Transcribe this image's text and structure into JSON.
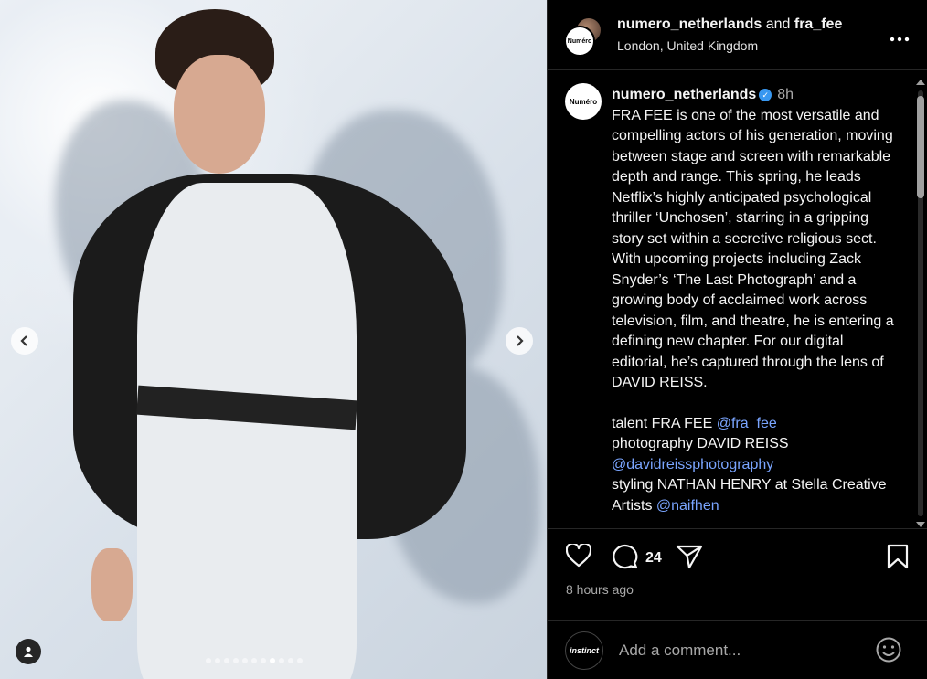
{
  "post": {
    "author": "numero_netherlands",
    "conjunction": "and",
    "collaborator": "fra_fee",
    "location": "London, United Kingdom",
    "author_avatar_text": "Numéro"
  },
  "caption": {
    "username": "numero_netherlands",
    "time": "8h",
    "paragraph": "FRA FEE is one of the most versatile and compelling actors of his generation, moving between stage and screen with remarkable depth and range. This spring, he leads Netflix’s highly anticipated psychological thriller ‘Unchosen’, starring in a gripping story set within a secretive religious sect. With upcoming projects including Zack Snyder’s ‘The Last Photograph’ and a growing body of acclaimed work across television, film, and theatre, he is entering a defining new chapter. For our digital editorial, he’s captured through the lens of DAVID REISS.",
    "credits": [
      {
        "label": "talent FRA FEE ",
        "mention": "@fra_fee"
      },
      {
        "label": "photography DAVID REISS ",
        "mention": "@davidreissphotography"
      },
      {
        "label": "styling NATHAN HENRY at Stella Creative Artists ",
        "mention": "@naifhen"
      }
    ]
  },
  "actions": {
    "comment_count": "24",
    "time_ago": "8 hours ago"
  },
  "comment_box": {
    "placeholder": "Add a comment...",
    "avatar_text": "instinct"
  },
  "carousel": {
    "total": 11,
    "active_index": 7
  },
  "colors": {
    "mention": "#7aa5ff",
    "verified": "#3897f0",
    "background": "#000000"
  },
  "icons": [
    "chevron-left-icon",
    "chevron-right-icon",
    "user-tag-icon",
    "more-icon",
    "verified-icon",
    "heart-icon",
    "comment-icon",
    "share-icon",
    "bookmark-icon",
    "emoji-icon"
  ]
}
